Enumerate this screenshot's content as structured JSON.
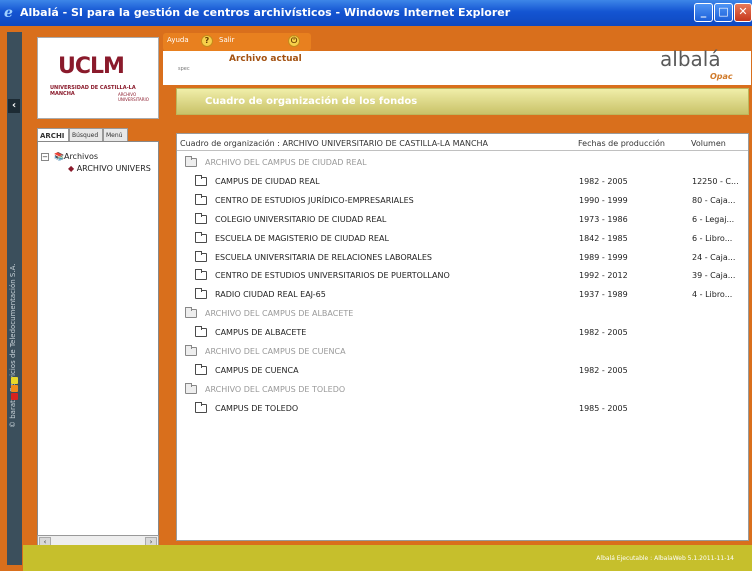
{
  "window": {
    "title": "Albalá - SI para la gestión de centros archivísticos - Windows Internet Explorer"
  },
  "sidebar": {
    "vertical_text": "© baratz- Servicios de Teledocumentación  S.A."
  },
  "logo": {
    "name": "UCLM",
    "line1": "UNIVERSIDAD DE CASTILLA-LA MANCHA",
    "line2": "ARCHIVO UNIVERSITARIO"
  },
  "topmenu": {
    "help": "Ayuda",
    "exit": "Salir"
  },
  "header": {
    "title": "Archivo actual",
    "user": "spec",
    "brand": "albalá",
    "brand_sub": "Opac"
  },
  "banner": {
    "title": "Cuadro de organización de los fondos"
  },
  "tabs": [
    {
      "label": "ARCHI"
    },
    {
      "label": "Búsqued"
    },
    {
      "label": "Menú"
    }
  ],
  "tree": {
    "root": "Archivos",
    "child": "ARCHIVO UNIVERS"
  },
  "table": {
    "headers": [
      "Cuadro de organización : ARCHIVO UNIVERSITARIO DE CASTILLA-LA MANCHA",
      "Fechas de producción",
      "Volumen"
    ],
    "rows": [
      {
        "name": "ARCHIVO DEL CAMPUS DE CIUDAD REAL",
        "dates": "",
        "volume": "",
        "group": true
      },
      {
        "name": "CAMPUS DE CIUDAD REAL",
        "dates": "1982 - 2005",
        "volume": "12250 - C...",
        "group": false
      },
      {
        "name": "CENTRO DE ESTUDIOS JURÍDICO-EMPRESARIALES",
        "dates": "1990 - 1999",
        "volume": "80 - Caja...",
        "group": false
      },
      {
        "name": "COLEGIO UNIVERSITARIO DE CIUDAD REAL",
        "dates": "1973 - 1986",
        "volume": "6 - Legaj...",
        "group": false
      },
      {
        "name": "ESCUELA DE MAGISTERIO DE CIUDAD REAL",
        "dates": "1842 - 1985",
        "volume": "6 - Libro...",
        "group": false
      },
      {
        "name": "ESCUELA UNIVERSITARIA DE RELACIONES LABORALES",
        "dates": "1989 - 1999",
        "volume": "24 - Caja...",
        "group": false
      },
      {
        "name": "CENTRO DE ESTUDIOS UNIVERSITARIOS DE PUERTOLLANO",
        "dates": "1992 - 2012",
        "volume": "39 - Caja...",
        "group": false
      },
      {
        "name": "RADIO CIUDAD REAL EAJ-65",
        "dates": "1937 - 1989",
        "volume": "4 - Libro...",
        "group": false
      },
      {
        "name": "ARCHIVO DEL CAMPUS DE ALBACETE",
        "dates": "",
        "volume": "",
        "group": true
      },
      {
        "name": "CAMPUS DE ALBACETE",
        "dates": "1982 - 2005",
        "volume": "",
        "group": false
      },
      {
        "name": "ARCHIVO DEL CAMPUS DE CUENCA",
        "dates": "",
        "volume": "",
        "group": true
      },
      {
        "name": "CAMPUS DE CUENCA",
        "dates": "1982 - 2005",
        "volume": "",
        "group": false
      },
      {
        "name": "ARCHIVO DEL CAMPUS DE TOLEDO",
        "dates": "",
        "volume": "",
        "group": true
      },
      {
        "name": "CAMPUS DE TOLEDO",
        "dates": "1985 - 2005",
        "volume": "",
        "group": false
      }
    ]
  },
  "status": {
    "text": "Albalá Ejecutable : AlbalaWeb 5.1.2011-11-14"
  }
}
